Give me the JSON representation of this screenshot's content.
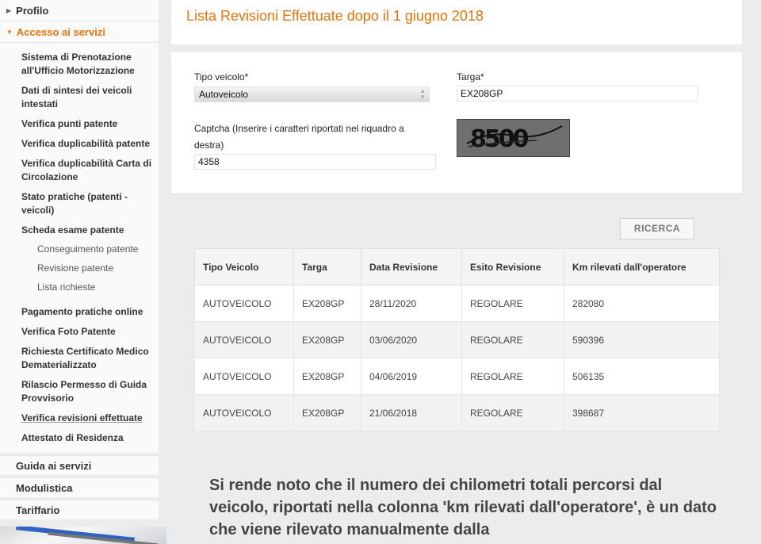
{
  "sidebar": {
    "profilo": "Profilo",
    "accesso": "Accesso ai servizi",
    "items": [
      {
        "label": "Sistema di Prenotazione all'Ufficio Motorizzazione"
      },
      {
        "label": "Dati di sintesi dei veicoli intestati"
      },
      {
        "label": "Verifica punti patente"
      },
      {
        "label": "Verifica duplicabilità  patente"
      },
      {
        "label": "Verifica duplicabilità Carta di Circolazione"
      },
      {
        "label": "Stato pratiche (patenti - veicoli)"
      },
      {
        "label": "Scheda esame patente"
      }
    ],
    "subitems": [
      {
        "label": "Conseguimento patente"
      },
      {
        "label": "Revisione patente"
      },
      {
        "label": "Lista richieste"
      }
    ],
    "items2": [
      {
        "label": "Pagamento pratiche online"
      },
      {
        "label": "Verifica Foto Patente"
      },
      {
        "label": "Richiesta Certificato Medico Dematerializzato"
      },
      {
        "label": "Rilascio Permesso di Guida Provvisorio"
      },
      {
        "label": "Verifica revisioni effettuate"
      },
      {
        "label": "Attestato di Residenza"
      }
    ],
    "sections": [
      {
        "label": "Guida ai servizi"
      },
      {
        "label": "Modulistica"
      },
      {
        "label": "Tariffario"
      }
    ]
  },
  "page": {
    "title": "Lista Revisioni Effettuate dopo il 1 giugno 2018"
  },
  "form": {
    "tipo_label": "Tipo veicolo*",
    "tipo_value": "Autoveicolo",
    "targa_label": "Targa*",
    "targa_value": "EX208GP",
    "captcha_label": "Captcha (Inserire i caratteri riportati nel riquadro a destra)",
    "captcha_value": "4358",
    "captcha_image_text": "8500",
    "search_button": "RICERCA"
  },
  "table": {
    "headers": [
      "Tipo Veicolo",
      "Targa",
      "Data Revisione",
      "Esito Revisione",
      "Km rilevati dall'operatore"
    ],
    "rows": [
      [
        "AUTOVEICOLO",
        "EX208GP",
        "28/11/2020",
        "REGOLARE",
        "282080"
      ],
      [
        "AUTOVEICOLO",
        "EX208GP",
        "03/06/2020",
        "REGOLARE",
        "590396"
      ],
      [
        "AUTOVEICOLO",
        "EX208GP",
        "04/06/2019",
        "REGOLARE",
        "506135"
      ],
      [
        "AUTOVEICOLO",
        "EX208GP",
        "21/06/2018",
        "REGOLARE",
        "398687"
      ]
    ]
  },
  "notice": "Si rende noto che il numero dei chilometri totali percorsi dal veicolo, riportati nella colonna 'km rilevati dall'operatore', è un dato che viene rilevato manualmente dalla",
  "colors": {
    "accent": "#e8730c",
    "background": "#ececec",
    "panel": "#ffffff"
  }
}
